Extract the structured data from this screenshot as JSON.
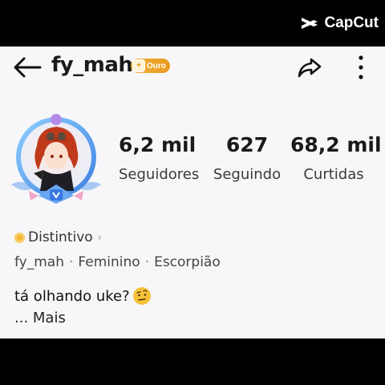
{
  "watermark": {
    "text": "CapCut"
  },
  "header": {
    "username": "fy_mah",
    "badge_label": "Ouro"
  },
  "stats": [
    {
      "value": "6,2 mil",
      "label": "Seguidores"
    },
    {
      "value": "627",
      "label": "Seguindo"
    },
    {
      "value": "68,2 mil",
      "label": "Curtidas"
    }
  ],
  "profile": {
    "distintivo_label": "Distintivo",
    "info": [
      "fy_mah",
      "Feminino",
      "Escorpião"
    ],
    "bio": "tá olhando uke?",
    "more_label": "... Mais"
  },
  "colors": {
    "badge": "#e89a1e",
    "avatar_ring": "#5aa8f0",
    "background": "#f7f7f9"
  }
}
